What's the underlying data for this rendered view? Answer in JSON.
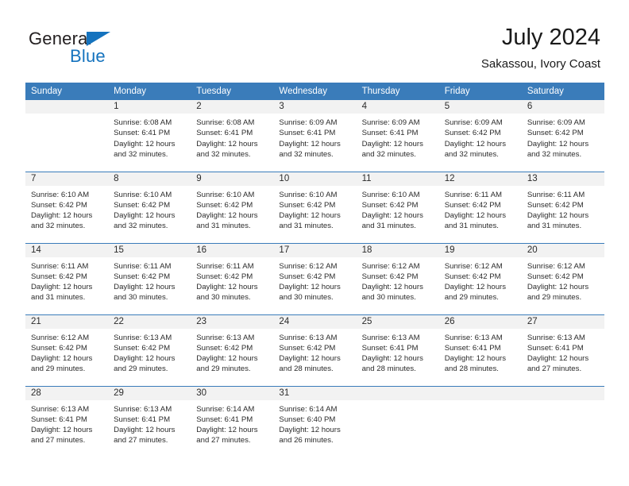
{
  "brand": {
    "name_part1": "General",
    "name_part2": "Blue",
    "triangle_icon": "triangle-icon",
    "accent_color": "#1573be"
  },
  "header": {
    "title": "July 2024",
    "subtitle": "Sakassou, Ivory Coast"
  },
  "theme": {
    "header_bg": "#3a7cba",
    "daynum_bg": "#f2f2f2",
    "text": "#2b2b2b"
  },
  "weekday_headers": [
    "Sunday",
    "Monday",
    "Tuesday",
    "Wednesday",
    "Thursday",
    "Friday",
    "Saturday"
  ],
  "weeks": [
    [
      {
        "day": "",
        "info": ""
      },
      {
        "day": "1",
        "info": "Sunrise: 6:08 AM\nSunset: 6:41 PM\nDaylight: 12 hours\nand 32 minutes."
      },
      {
        "day": "2",
        "info": "Sunrise: 6:08 AM\nSunset: 6:41 PM\nDaylight: 12 hours\nand 32 minutes."
      },
      {
        "day": "3",
        "info": "Sunrise: 6:09 AM\nSunset: 6:41 PM\nDaylight: 12 hours\nand 32 minutes."
      },
      {
        "day": "4",
        "info": "Sunrise: 6:09 AM\nSunset: 6:41 PM\nDaylight: 12 hours\nand 32 minutes."
      },
      {
        "day": "5",
        "info": "Sunrise: 6:09 AM\nSunset: 6:42 PM\nDaylight: 12 hours\nand 32 minutes."
      },
      {
        "day": "6",
        "info": "Sunrise: 6:09 AM\nSunset: 6:42 PM\nDaylight: 12 hours\nand 32 minutes."
      }
    ],
    [
      {
        "day": "7",
        "info": "Sunrise: 6:10 AM\nSunset: 6:42 PM\nDaylight: 12 hours\nand 32 minutes."
      },
      {
        "day": "8",
        "info": "Sunrise: 6:10 AM\nSunset: 6:42 PM\nDaylight: 12 hours\nand 32 minutes."
      },
      {
        "day": "9",
        "info": "Sunrise: 6:10 AM\nSunset: 6:42 PM\nDaylight: 12 hours\nand 31 minutes."
      },
      {
        "day": "10",
        "info": "Sunrise: 6:10 AM\nSunset: 6:42 PM\nDaylight: 12 hours\nand 31 minutes."
      },
      {
        "day": "11",
        "info": "Sunrise: 6:10 AM\nSunset: 6:42 PM\nDaylight: 12 hours\nand 31 minutes."
      },
      {
        "day": "12",
        "info": "Sunrise: 6:11 AM\nSunset: 6:42 PM\nDaylight: 12 hours\nand 31 minutes."
      },
      {
        "day": "13",
        "info": "Sunrise: 6:11 AM\nSunset: 6:42 PM\nDaylight: 12 hours\nand 31 minutes."
      }
    ],
    [
      {
        "day": "14",
        "info": "Sunrise: 6:11 AM\nSunset: 6:42 PM\nDaylight: 12 hours\nand 31 minutes."
      },
      {
        "day": "15",
        "info": "Sunrise: 6:11 AM\nSunset: 6:42 PM\nDaylight: 12 hours\nand 30 minutes."
      },
      {
        "day": "16",
        "info": "Sunrise: 6:11 AM\nSunset: 6:42 PM\nDaylight: 12 hours\nand 30 minutes."
      },
      {
        "day": "17",
        "info": "Sunrise: 6:12 AM\nSunset: 6:42 PM\nDaylight: 12 hours\nand 30 minutes."
      },
      {
        "day": "18",
        "info": "Sunrise: 6:12 AM\nSunset: 6:42 PM\nDaylight: 12 hours\nand 30 minutes."
      },
      {
        "day": "19",
        "info": "Sunrise: 6:12 AM\nSunset: 6:42 PM\nDaylight: 12 hours\nand 29 minutes."
      },
      {
        "day": "20",
        "info": "Sunrise: 6:12 AM\nSunset: 6:42 PM\nDaylight: 12 hours\nand 29 minutes."
      }
    ],
    [
      {
        "day": "21",
        "info": "Sunrise: 6:12 AM\nSunset: 6:42 PM\nDaylight: 12 hours\nand 29 minutes."
      },
      {
        "day": "22",
        "info": "Sunrise: 6:13 AM\nSunset: 6:42 PM\nDaylight: 12 hours\nand 29 minutes."
      },
      {
        "day": "23",
        "info": "Sunrise: 6:13 AM\nSunset: 6:42 PM\nDaylight: 12 hours\nand 29 minutes."
      },
      {
        "day": "24",
        "info": "Sunrise: 6:13 AM\nSunset: 6:42 PM\nDaylight: 12 hours\nand 28 minutes."
      },
      {
        "day": "25",
        "info": "Sunrise: 6:13 AM\nSunset: 6:41 PM\nDaylight: 12 hours\nand 28 minutes."
      },
      {
        "day": "26",
        "info": "Sunrise: 6:13 AM\nSunset: 6:41 PM\nDaylight: 12 hours\nand 28 minutes."
      },
      {
        "day": "27",
        "info": "Sunrise: 6:13 AM\nSunset: 6:41 PM\nDaylight: 12 hours\nand 27 minutes."
      }
    ],
    [
      {
        "day": "28",
        "info": "Sunrise: 6:13 AM\nSunset: 6:41 PM\nDaylight: 12 hours\nand 27 minutes."
      },
      {
        "day": "29",
        "info": "Sunrise: 6:13 AM\nSunset: 6:41 PM\nDaylight: 12 hours\nand 27 minutes."
      },
      {
        "day": "30",
        "info": "Sunrise: 6:14 AM\nSunset: 6:41 PM\nDaylight: 12 hours\nand 27 minutes."
      },
      {
        "day": "31",
        "info": "Sunrise: 6:14 AM\nSunset: 6:40 PM\nDaylight: 12 hours\nand 26 minutes."
      },
      {
        "day": "",
        "info": ""
      },
      {
        "day": "",
        "info": ""
      },
      {
        "day": "",
        "info": ""
      }
    ]
  ]
}
